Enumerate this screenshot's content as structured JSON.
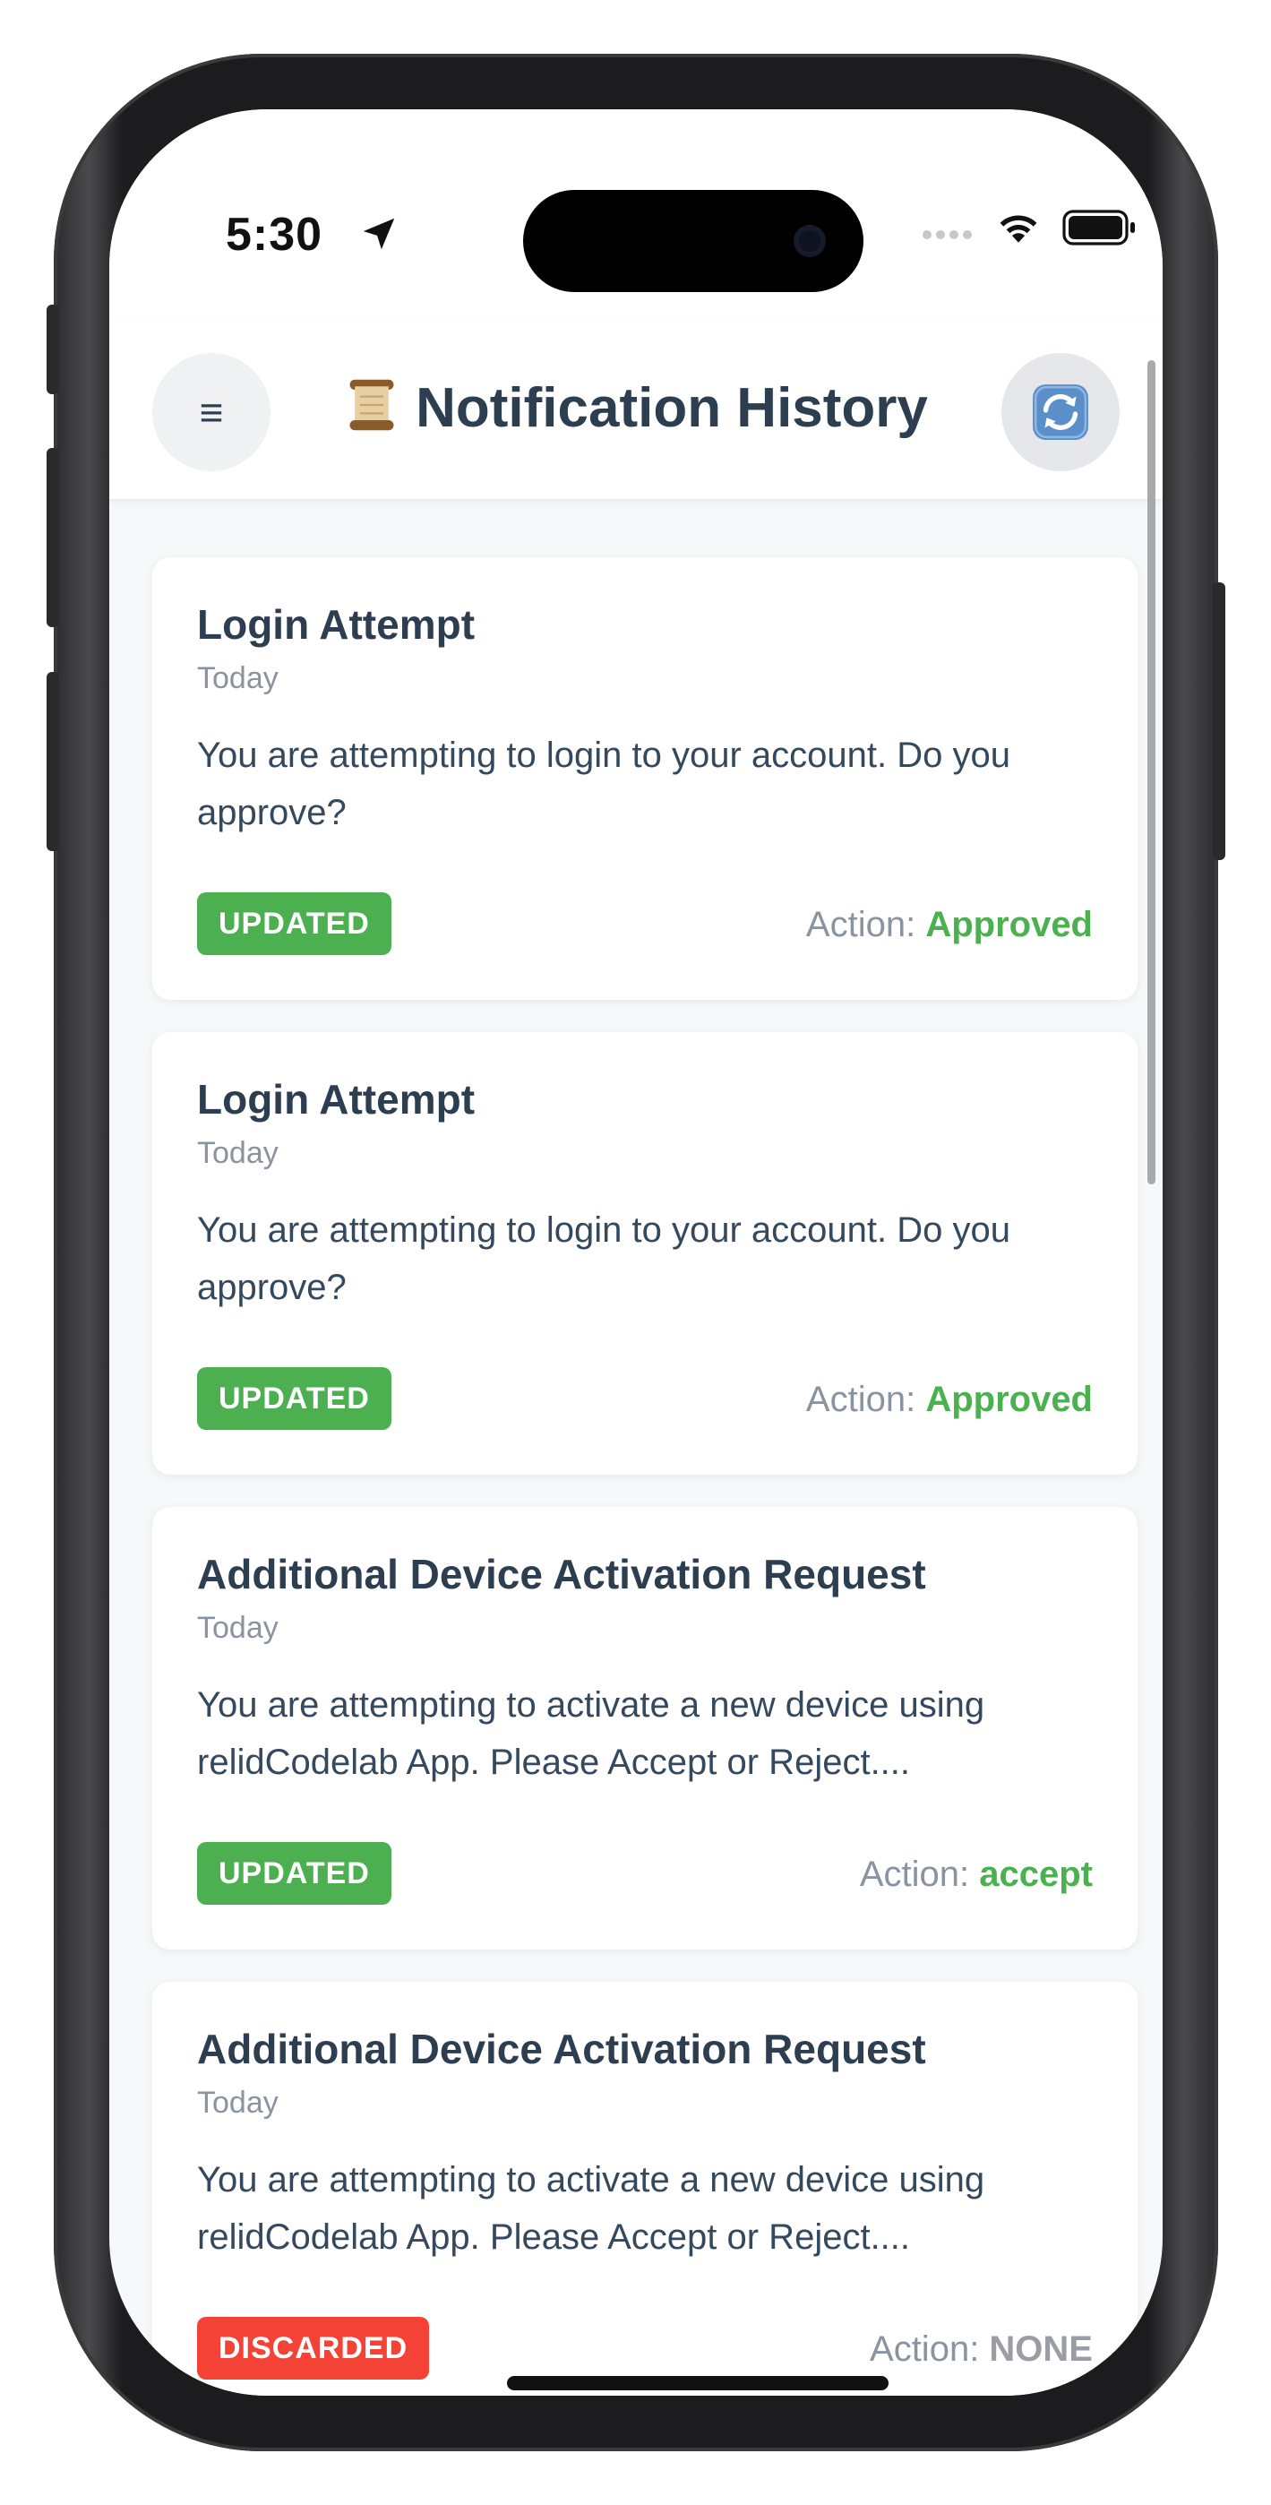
{
  "status_bar": {
    "time": "5:30",
    "icons": [
      "location-arrow-icon",
      "cellular-signal-icon",
      "wifi-icon",
      "battery-icon"
    ]
  },
  "header": {
    "title": "Notification History",
    "menu_glyph": "≡",
    "icons": {
      "title": "scroll-icon",
      "left": "hamburger-menu-icon",
      "right": "refresh-icon"
    }
  },
  "colors": {
    "title_text": "#2c3e50",
    "muted_text": "#8a94a0",
    "updated_badge": "#4caf50",
    "discarded_badge": "#f44336",
    "action_approved": "#4caf50"
  },
  "action_label": "Action: ",
  "notifications": [
    {
      "title": "Login Attempt",
      "date": "Today",
      "body": "You are attempting to login to your account. Do you approve?",
      "status": "UPDATED",
      "action": "Approved"
    },
    {
      "title": "Login Attempt",
      "date": "Today",
      "body": "You are attempting to login to your account. Do you approve?",
      "status": "UPDATED",
      "action": "Approved"
    },
    {
      "title": "Additional Device Activation Request",
      "date": "Today",
      "body": "You are attempting to activate a new device using relidCodelab App. Please Accept or Reject....",
      "status": "UPDATED",
      "action": "accept"
    },
    {
      "title": "Additional Device Activation Request",
      "date": "Today",
      "body": "You are attempting to activate a new device using relidCodelab App. Please Accept or Reject....",
      "status": "DISCARDED",
      "action": "NONE"
    }
  ]
}
